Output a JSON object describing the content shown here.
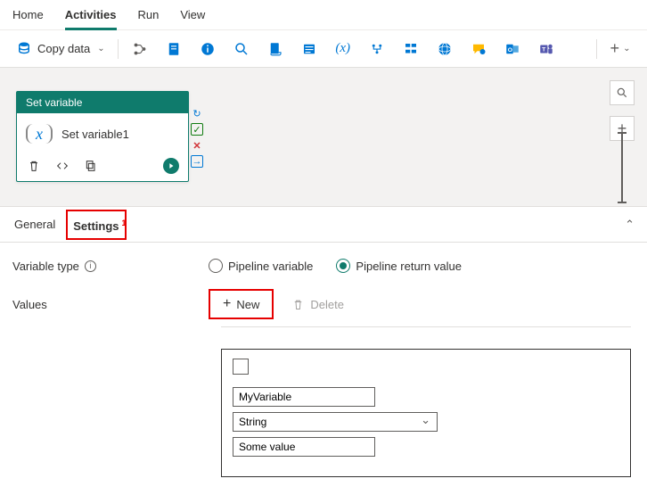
{
  "topnav": {
    "items": [
      "Home",
      "Activities",
      "Run",
      "View"
    ],
    "active": 1
  },
  "toolbar": {
    "copy_data_label": "Copy data"
  },
  "activity": {
    "header": "Set variable",
    "name": "Set variable1",
    "icon_glyph": "x"
  },
  "props": {
    "tabs": {
      "general": "General",
      "settings": "Settings",
      "settings_badge": "1"
    },
    "variable_type_label": "Variable type",
    "radio_pipeline_var": "Pipeline variable",
    "radio_return_value": "Pipeline return value",
    "values_label": "Values",
    "new_label": "New",
    "delete_label": "Delete",
    "value_row": {
      "name": "MyVariable",
      "type": "String",
      "value": "Some value"
    }
  }
}
